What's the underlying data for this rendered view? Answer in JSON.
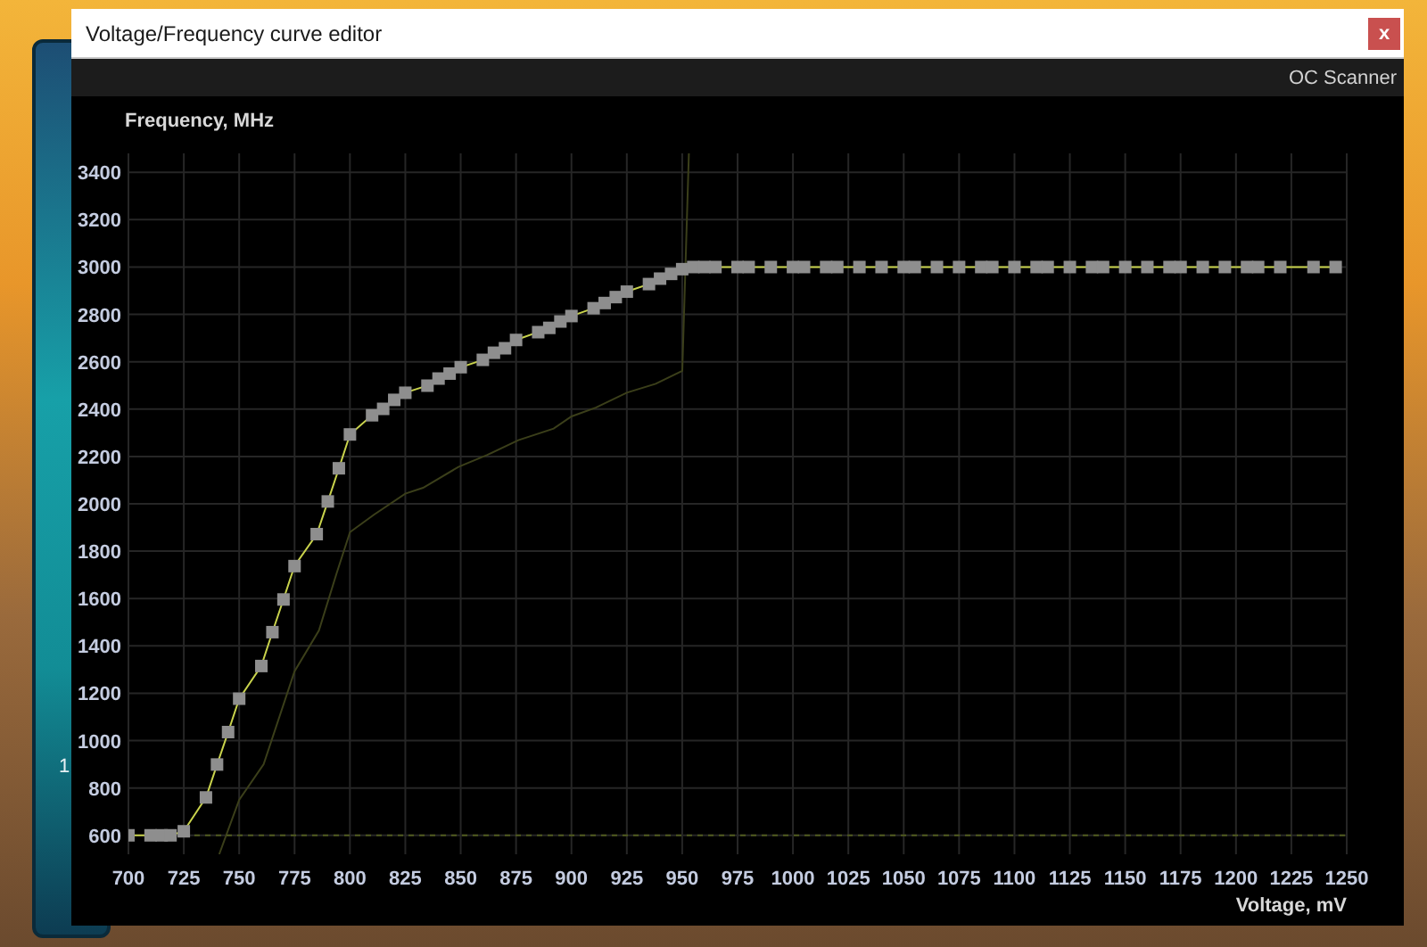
{
  "backdrop_text": "1",
  "window": {
    "title": "Voltage/Frequency curve editor",
    "close_label": "x"
  },
  "toolbar": {
    "button": "OC Scanner"
  },
  "curve_editor": {
    "chart_data": {
      "type": "line",
      "grid": true,
      "xlabel": "Voltage, mV",
      "ylabel": "Frequency, MHz",
      "xlim": [
        700,
        1250
      ],
      "ylim": [
        520,
        3480
      ],
      "xticks": [
        700,
        725,
        750,
        775,
        800,
        825,
        850,
        875,
        900,
        925,
        950,
        975,
        1000,
        1025,
        1050,
        1075,
        1100,
        1125,
        1150,
        1175,
        1200,
        1225,
        1250
      ],
      "yticks": [
        600,
        800,
        1000,
        1200,
        1400,
        1600,
        1800,
        2000,
        2200,
        2400,
        2600,
        2800,
        3000,
        3200,
        3400
      ],
      "series": [
        {
          "color": "#c9d34c",
          "marker": "square",
          "x": [
            700,
            710,
            715,
            719,
            725,
            735,
            740,
            745,
            750,
            760,
            765,
            770,
            775,
            785,
            790,
            795,
            800,
            810,
            815,
            820,
            825,
            835,
            840,
            845,
            850,
            860,
            865,
            870,
            875,
            885,
            890,
            895,
            900,
            910,
            915,
            920,
            925,
            935,
            940,
            945,
            950,
            955,
            960,
            965,
            975,
            980,
            990,
            1000,
            1005,
            1015,
            1020,
            1030,
            1040,
            1050,
            1055,
            1065,
            1075,
            1085,
            1090,
            1100,
            1110,
            1115,
            1125,
            1135,
            1140,
            1150,
            1160,
            1170,
            1175,
            1185,
            1195,
            1205,
            1210,
            1220,
            1235,
            1245
          ],
          "values": [
            600,
            600,
            600,
            600,
            617,
            760,
            899,
            1036,
            1177,
            1315,
            1458,
            1596,
            1737,
            1872,
            2010,
            2150,
            2293,
            2374,
            2401,
            2439,
            2469,
            2499,
            2529,
            2550,
            2577,
            2608,
            2638,
            2657,
            2692,
            2725,
            2743,
            2770,
            2793,
            2826,
            2848,
            2873,
            2896,
            2928,
            2951,
            2971,
            2991,
            3000,
            3000,
            3000,
            3000,
            3000,
            3000,
            3000,
            3000,
            3000,
            3000,
            3000,
            3000,
            3000,
            3000,
            3000,
            3000,
            3000,
            3000,
            3000,
            3000,
            3000,
            3000,
            3000,
            3000,
            3000,
            3000,
            3000,
            3000,
            3000,
            3000,
            3000,
            3000,
            3000,
            3000,
            3000
          ]
        },
        {
          "color": "#3b3f1a",
          "line_style": "solid",
          "x": [
            741,
            750,
            761,
            775,
            786,
            794,
            800,
            811,
            825,
            833,
            849,
            862,
            876,
            892,
            900,
            911,
            925,
            938,
            950,
            951,
            953
          ],
          "values": [
            520,
            750,
            900,
            1292,
            1465,
            1706,
            1880,
            1955,
            2043,
            2068,
            2156,
            2206,
            2269,
            2318,
            2369,
            2406,
            2469,
            2507,
            2562,
            2858,
            3480
          ]
        },
        {
          "color": "#4f5a1e",
          "line_style": "dashed",
          "x": [
            725,
            1250
          ],
          "values": [
            600,
            600
          ]
        }
      ]
    }
  }
}
